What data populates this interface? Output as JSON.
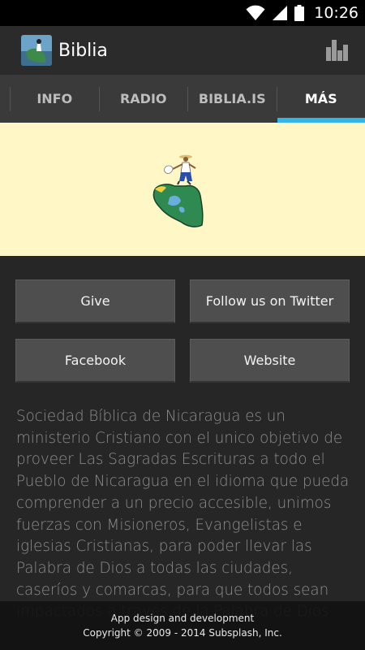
{
  "status_bar": {
    "time": "10:26"
  },
  "app": {
    "title": "Biblia"
  },
  "tabs": [
    {
      "label": "INFO",
      "active": false
    },
    {
      "label": "RADIO",
      "active": false
    },
    {
      "label": "BIBLIA.IS",
      "active": false
    },
    {
      "label": "MÁS",
      "active": true
    }
  ],
  "buttons": {
    "give": "Give",
    "twitter": "Follow us on Twitter",
    "facebook": "Facebook",
    "website": "Website"
  },
  "description": "Sociedad Bíblica de Nicaragua es un ministerio Cristiano con el unico objetivo de proveer Las Sagradas Escrituras a todo el Pueblo de Nicaragua en el idioma que pueda comprender a un precio accesible, unimos fuerzas con Misioneros, Evangelistas e iglesias Cristianas, para poder llevar las Palabra de Dios a todas las ciudades, caseríos y comarcas, para que todos sean impactados a través de la Palabra de Dios.",
  "footer": {
    "line1": "App design and development",
    "line2": "Copyright © 2009 - 2014 Subsplash, Inc."
  },
  "colors": {
    "accent": "#33b5e5",
    "banner_bg": "#fff8c6",
    "background": "#262626"
  }
}
